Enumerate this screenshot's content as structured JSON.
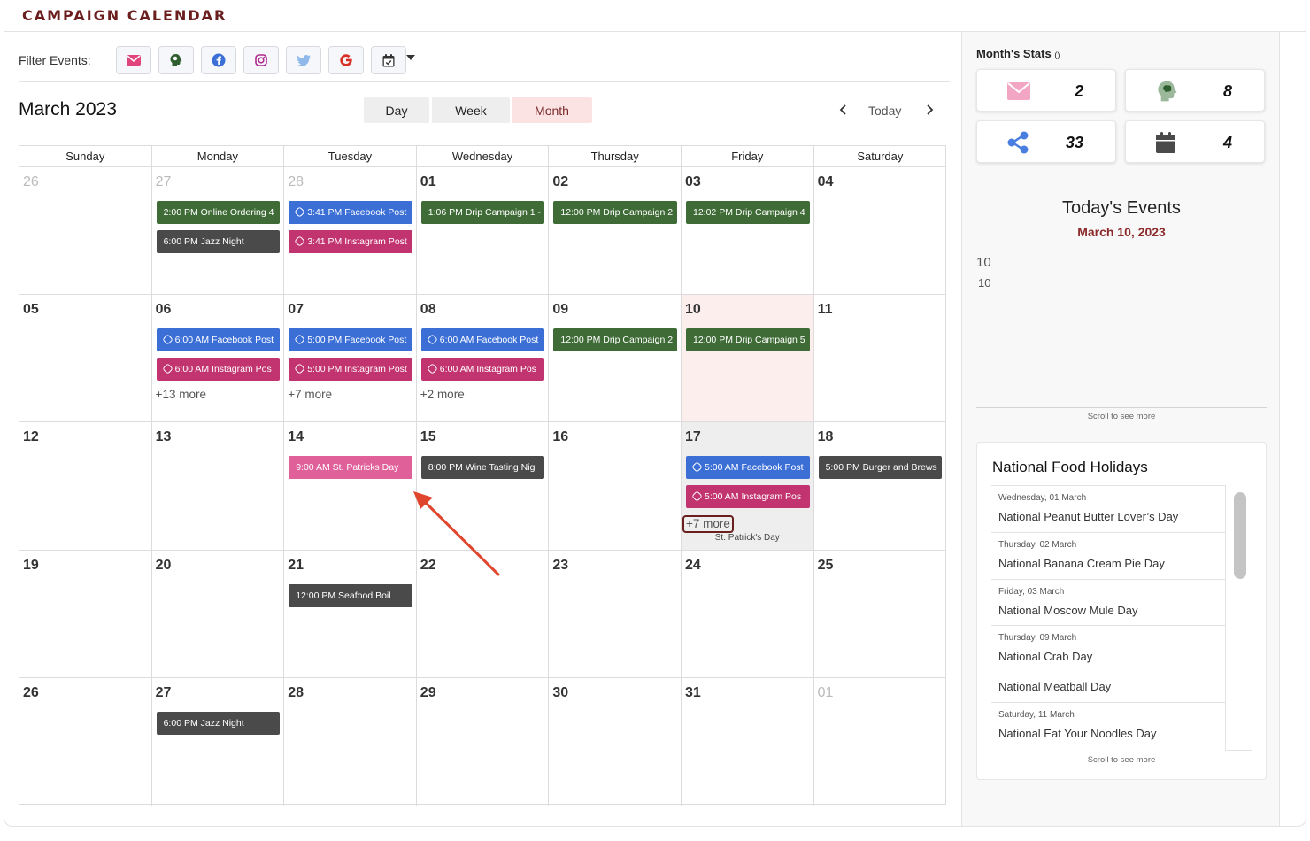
{
  "header": {
    "title": "CAMPAIGN CALENDAR"
  },
  "filter": {
    "label": "Filter Events:",
    "buttons": [
      "email-filter",
      "drip-filter",
      "facebook-filter",
      "instagram-filter",
      "twitter-filter",
      "google-filter",
      "calendar-filter"
    ]
  },
  "toolbar": {
    "month_title": "March 2023",
    "views": [
      "Day",
      "Week",
      "Month"
    ],
    "active_view": "Month",
    "today_label": "Today"
  },
  "calendar": {
    "weekdays": [
      "Sunday",
      "Monday",
      "Tuesday",
      "Wednesday",
      "Thursday",
      "Friday",
      "Saturday"
    ],
    "weeks": [
      [
        {
          "day": "26",
          "other": true,
          "events": []
        },
        {
          "day": "27",
          "other": true,
          "events": [
            {
              "text": "2:00 PM Online Ordering 4",
              "color": "#3f6b37"
            },
            {
              "text": "6:00 PM Jazz Night",
              "color": "#4a4a4a"
            }
          ]
        },
        {
          "day": "28",
          "other": true,
          "events": [
            {
              "text": "3:41 PM Facebook Post",
              "color": "#3b6fd6",
              "link": true
            },
            {
              "text": "3:41 PM Instagram Post",
              "color": "#c23470",
              "link": true
            }
          ]
        },
        {
          "day": "01",
          "events": [
            {
              "text": "1:06 PM Drip Campaign 1 - ",
              "color": "#3f6b37"
            }
          ]
        },
        {
          "day": "02",
          "events": [
            {
              "text": "12:00 PM Drip Campaign 2",
              "color": "#3f6b37"
            }
          ]
        },
        {
          "day": "03",
          "events": [
            {
              "text": "12:02 PM Drip Campaign 4",
              "color": "#3f6b37"
            }
          ]
        },
        {
          "day": "04",
          "events": []
        }
      ],
      [
        {
          "day": "05",
          "events": []
        },
        {
          "day": "06",
          "events": [
            {
              "text": "6:00 AM Facebook Post",
              "color": "#3b6fd6",
              "link": true
            },
            {
              "text": "6:00 AM Instagram Pos",
              "color": "#c23470",
              "link": true
            }
          ],
          "more": "+13 more"
        },
        {
          "day": "07",
          "events": [
            {
              "text": "5:00 PM Facebook Post",
              "color": "#3b6fd6",
              "link": true
            },
            {
              "text": "5:00 PM Instagram Post",
              "color": "#c23470",
              "link": true
            }
          ],
          "more": "+7 more"
        },
        {
          "day": "08",
          "events": [
            {
              "text": "6:00 AM Facebook Post",
              "color": "#3b6fd6",
              "link": true
            },
            {
              "text": "6:00 AM Instagram Pos",
              "color": "#c23470",
              "link": true
            }
          ],
          "more": "+2 more"
        },
        {
          "day": "09",
          "events": [
            {
              "text": "12:00 PM Drip Campaign 2",
              "color": "#3f6b37"
            }
          ]
        },
        {
          "day": "10",
          "today": true,
          "events": [
            {
              "text": "12:00 PM Drip Campaign 5",
              "color": "#3f6b37"
            }
          ]
        },
        {
          "day": "11",
          "events": []
        }
      ],
      [
        {
          "day": "12",
          "events": []
        },
        {
          "day": "13",
          "events": []
        },
        {
          "day": "14",
          "events": [
            {
              "text": "9:00 AM St. Patricks Day",
              "color": "#e0609a"
            }
          ]
        },
        {
          "day": "15",
          "events": [
            {
              "text": "8:00 PM Wine Tasting Nig",
              "color": "#4a4a4a"
            }
          ]
        },
        {
          "day": "16",
          "events": []
        },
        {
          "day": "17",
          "highlight": true,
          "events": [
            {
              "text": "5:00 AM Facebook Post",
              "color": "#3b6fd6",
              "link": true
            },
            {
              "text": "5:00 AM Instagram Pos",
              "color": "#c23470",
              "link": true
            }
          ],
          "more": "+7 more",
          "more_boxed": true,
          "note": "St. Patrick's Day"
        },
        {
          "day": "18",
          "events": [
            {
              "text": "5:00 PM Burger and Brews",
              "color": "#4a4a4a"
            }
          ]
        }
      ],
      [
        {
          "day": "19",
          "events": []
        },
        {
          "day": "20",
          "events": []
        },
        {
          "day": "21",
          "events": [
            {
              "text": "12:00 PM Seafood Boil",
              "color": "#4a4a4a"
            }
          ]
        },
        {
          "day": "22",
          "events": []
        },
        {
          "day": "23",
          "events": []
        },
        {
          "day": "24",
          "events": []
        },
        {
          "day": "25",
          "events": []
        }
      ],
      [
        {
          "day": "26",
          "events": []
        },
        {
          "day": "27",
          "events": [
            {
              "text": "6:00 PM Jazz Night",
              "color": "#4a4a4a"
            }
          ]
        },
        {
          "day": "28",
          "events": []
        },
        {
          "day": "29",
          "events": []
        },
        {
          "day": "30",
          "events": []
        },
        {
          "day": "31",
          "events": []
        },
        {
          "day": "01",
          "other": true,
          "events": []
        }
      ]
    ]
  },
  "stats": {
    "title": "Month's Stats",
    "title_suffix": "()",
    "items": [
      {
        "icon": "envelope-icon",
        "value": "2"
      },
      {
        "icon": "brain-icon",
        "value": "8"
      },
      {
        "icon": "share-icon",
        "value": "33"
      },
      {
        "icon": "calendar-icon",
        "value": "4"
      }
    ]
  },
  "today_events": {
    "title": "Today's Events",
    "date": "March 10, 2023",
    "line1": "10",
    "line2": "10",
    "scroll_hint": "Scroll to see more"
  },
  "food_holidays": {
    "title": "National Food Holidays",
    "items": [
      {
        "date": "Wednesday, 01 March",
        "name": "National Peanut Butter Lover’s Day"
      },
      {
        "date": "Thursday, 02 March",
        "name": "National Banana Cream Pie Day"
      },
      {
        "date": "Friday, 03 March",
        "name": "National Moscow Mule Day"
      },
      {
        "date": "Thursday, 09 March",
        "name": "National Crab Day"
      },
      {
        "date": "",
        "name": "National Meatball Day"
      },
      {
        "date": "Saturday, 11 March",
        "name": "National Eat Your Noodles Day"
      }
    ],
    "scroll_hint": "Scroll to see more"
  },
  "colors": {
    "brand": "#6b1e1e",
    "accent_date": "#8b2b2b",
    "today_bg": "#fdeeee",
    "facebook": "#3b6fd6",
    "instagram": "#c23470",
    "drip": "#3f6b37",
    "event_dark": "#4a4a4a",
    "annotation": "#e0452e"
  }
}
